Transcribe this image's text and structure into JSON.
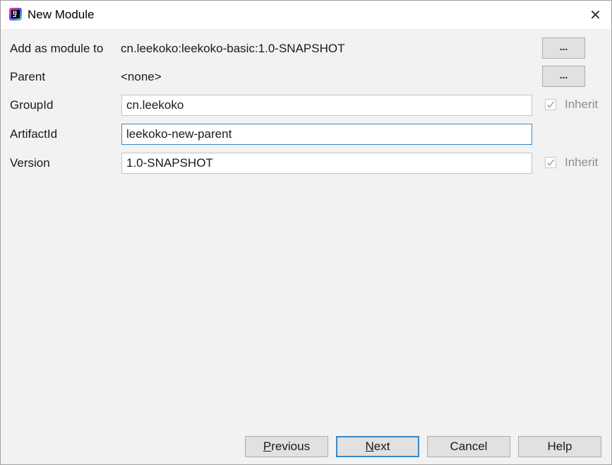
{
  "window": {
    "title": "New Module",
    "close_glyph": "✕"
  },
  "form": {
    "add_as_module_label": "Add as module to",
    "add_as_module_value": "cn.leekoko:leekoko-basic:1.0-SNAPSHOT",
    "parent_label": "Parent",
    "parent_value": "<none>",
    "groupid_label": "GroupId",
    "groupid_value": "cn.leekoko",
    "groupid_inherit_label": "Inherit",
    "groupid_inherit_checked": true,
    "artifactid_label": "ArtifactId",
    "artifactid_value": "leekoko-new-parent",
    "version_label": "Version",
    "version_value": "1.0-SNAPSHOT",
    "version_inherit_label": "Inherit",
    "version_inherit_checked": true,
    "browse_label": "..."
  },
  "buttons": {
    "previous_mnemonic": "P",
    "previous_rest": "revious",
    "next_mnemonic": "N",
    "next_rest": "ext",
    "cancel": "Cancel",
    "help": "Help"
  },
  "colors": {
    "focus_border": "#3b88c4",
    "dialog_bg": "#f2f2f2",
    "disabled_text": "#8e8e8e"
  },
  "icons": {
    "app": "intellij-idea-icon",
    "close": "close-icon",
    "check": "checkmark-icon"
  }
}
